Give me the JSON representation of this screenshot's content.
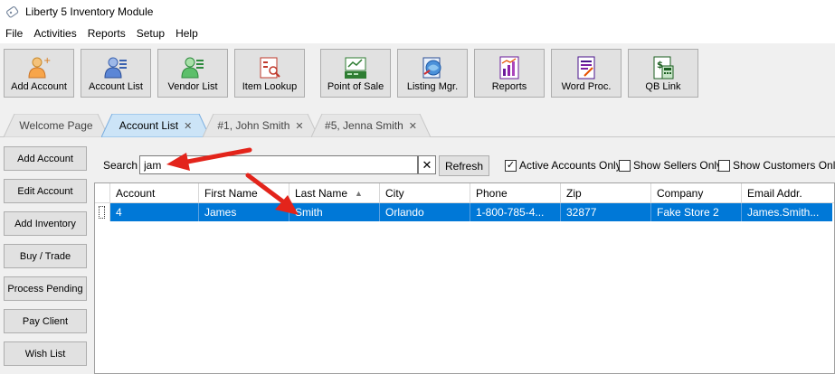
{
  "window": {
    "title": "Liberty 5 Inventory Module"
  },
  "menu": [
    "File",
    "Activities",
    "Reports",
    "Setup",
    "Help"
  ],
  "toolbar": [
    {
      "label": "Add Account",
      "icon": "add-account-icon"
    },
    {
      "label": "Account List",
      "icon": "account-list-icon"
    },
    {
      "label": "Vendor List",
      "icon": "vendor-list-icon"
    },
    {
      "label": "Item Lookup",
      "icon": "item-lookup-icon"
    },
    {
      "label": "Point of Sale",
      "icon": "point-of-sale-icon"
    },
    {
      "label": "Listing Mgr.",
      "icon": "listing-manager-icon"
    },
    {
      "label": "Reports",
      "icon": "reports-icon"
    },
    {
      "label": "Word Proc.",
      "icon": "word-processor-icon"
    },
    {
      "label": "QB Link",
      "icon": "qb-link-icon"
    }
  ],
  "tabs": [
    {
      "label": "Welcome Page",
      "closable": false,
      "active": false
    },
    {
      "label": "Account List",
      "closable": true,
      "active": true
    },
    {
      "label": "#1, John Smith",
      "closable": true,
      "active": false
    },
    {
      "label": "#5, Jenna Smith",
      "closable": true,
      "active": false
    }
  ],
  "sidebar": [
    "Add Account",
    "Edit Account",
    "Add Inventory",
    "Buy / Trade",
    "Process Pending",
    "Pay Client",
    "Wish List"
  ],
  "search": {
    "label": "Search",
    "value": "jam",
    "clear_glyph": "✕",
    "refresh_label": "Refresh"
  },
  "filters": [
    {
      "label": "Active Accounts Only",
      "checked": true
    },
    {
      "label": "Show Sellers Only",
      "checked": false
    },
    {
      "label": "Show Customers Only",
      "checked": false
    }
  ],
  "grid": {
    "columns": [
      "Account",
      "First Name",
      "Last Name",
      "City",
      "Phone",
      "Zip",
      "Company",
      "Email Addr."
    ],
    "sort_indicator": "▲",
    "rows": [
      [
        "4",
        "James",
        "Smith",
        "Orlando",
        "1-800-785-4...",
        "32877",
        "Fake Store 2",
        "James.Smith..."
      ]
    ]
  },
  "colors": {
    "selection": "#0078d7",
    "active_tab": "#cce4f7",
    "arrow": "#e3241b"
  }
}
